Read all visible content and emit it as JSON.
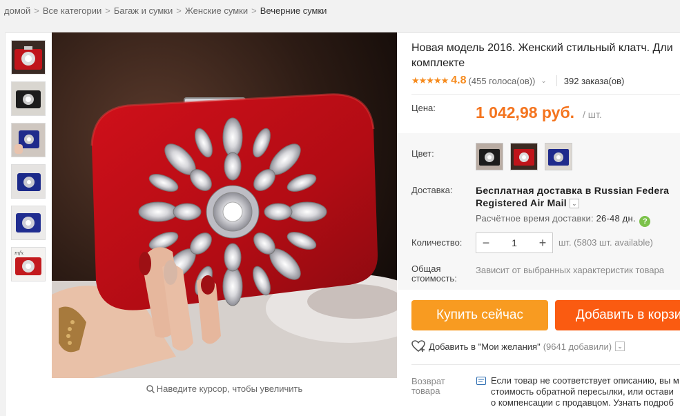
{
  "breadcrumb": [
    {
      "label": "домой"
    },
    {
      "label": "Все категории"
    },
    {
      "label": "Багаж и сумки"
    },
    {
      "label": "Женские сумки"
    },
    {
      "label": "Вечерние сумки"
    }
  ],
  "breadcrumb_separator": ">",
  "gallery": {
    "zoom_hint": "Наведите курсор, чтобы увеличить",
    "thumbnails": [
      {
        "name": "thumb-red-clutch-closeup"
      },
      {
        "name": "thumb-black-clutch"
      },
      {
        "name": "thumb-blue-clutch-hand"
      },
      {
        "name": "thumb-blue-clutch-side"
      },
      {
        "name": "thumb-blue-clutch-front"
      },
      {
        "name": "thumb-red-clutch-front"
      }
    ]
  },
  "product": {
    "title_line1": "Новая модель 2016. Женский стильный клатч. Дли",
    "title_line2": "комплекте",
    "stars": "★★★★★",
    "rating": "4.8",
    "votes": "(455 голоса(ов))",
    "orders": "392 заказа(ов)",
    "price_label": "Цена:",
    "price": "1 042,98 руб.",
    "per_unit": "/ шт.",
    "color_label": "Цвет:",
    "shipping_label": "Доставка:",
    "shipping_line1": "Бесплатная доставка в Russian Federa",
    "shipping_line2": "Registered Air Mail",
    "delivery_time_label": "Расчётное время доставки:",
    "delivery_time_value": "26-48 дн.",
    "help_glyph": "?",
    "quantity_label": "Количество:",
    "quantity_value": "1",
    "minus_glyph": "−",
    "plus_glyph": "+",
    "quantity_note": "шт. (5803 шт. available)",
    "total_label_line1": "Общая",
    "total_label_line2": "стоимость:",
    "total_value": "Зависит от выбранных характеристик товара",
    "buy_now": "Купить сейчас",
    "add_to_cart": "Добавить в корзи",
    "wishlist": "Добавить в \"Мои желания\"",
    "wishlist_count": "(9641 добавили)",
    "return_label_line1": "Возврат",
    "return_label_line2": "товара",
    "return_line1": "Если товар не соответствует описанию, вы м",
    "return_line2": "стоимость обратной пересылки, или остави",
    "return_line3": "о компенсации с продавцом. Узнать подроб"
  },
  "colors": {
    "accent_orange": "#f4741e",
    "buy_now_bg": "#f89b21",
    "add_to_cart_bg": "#fa5b11",
    "clutch_red": "#c0141a",
    "help_green": "#7cc24a"
  },
  "icons": {
    "magnifier": "search-icon",
    "heart": "heart-icon",
    "return": "return-policy-icon",
    "dropdown": "chevron-down-icon",
    "help": "help-icon"
  }
}
